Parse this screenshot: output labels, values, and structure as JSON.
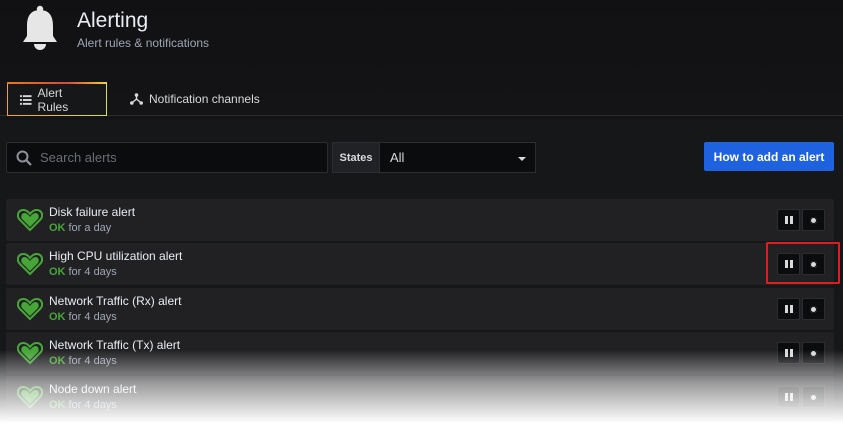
{
  "header": {
    "title": "Alerting",
    "subtitle": "Alert rules & notifications",
    "icon": "bell-icon"
  },
  "tabs": [
    {
      "label": "Alert Rules",
      "icon": "list-icon",
      "active": true
    },
    {
      "label": "Notification channels",
      "icon": "share-nodes-icon",
      "active": false
    }
  ],
  "filters": {
    "search_placeholder": "Search alerts",
    "search_value": "",
    "states_label": "States",
    "states_selected": "All"
  },
  "actions": {
    "add_alert_label": "How to add an alert",
    "add_alert_color": "#1f62e0"
  },
  "alerts": [
    {
      "name": "Disk failure alert",
      "state": "OK",
      "duration": "for a day"
    },
    {
      "name": "High CPU utilization alert",
      "state": "OK",
      "duration": "for 4 days"
    },
    {
      "name": "Network Traffic (Rx) alert",
      "state": "OK",
      "duration": "for 4 days"
    },
    {
      "name": "Network Traffic (Tx) alert",
      "state": "OK",
      "duration": "for 4 days"
    },
    {
      "name": "Node down alert",
      "state": "OK",
      "duration": "for 4 days"
    }
  ],
  "colors": {
    "ok": "#46a637",
    "highlight": "#e01c1c"
  }
}
